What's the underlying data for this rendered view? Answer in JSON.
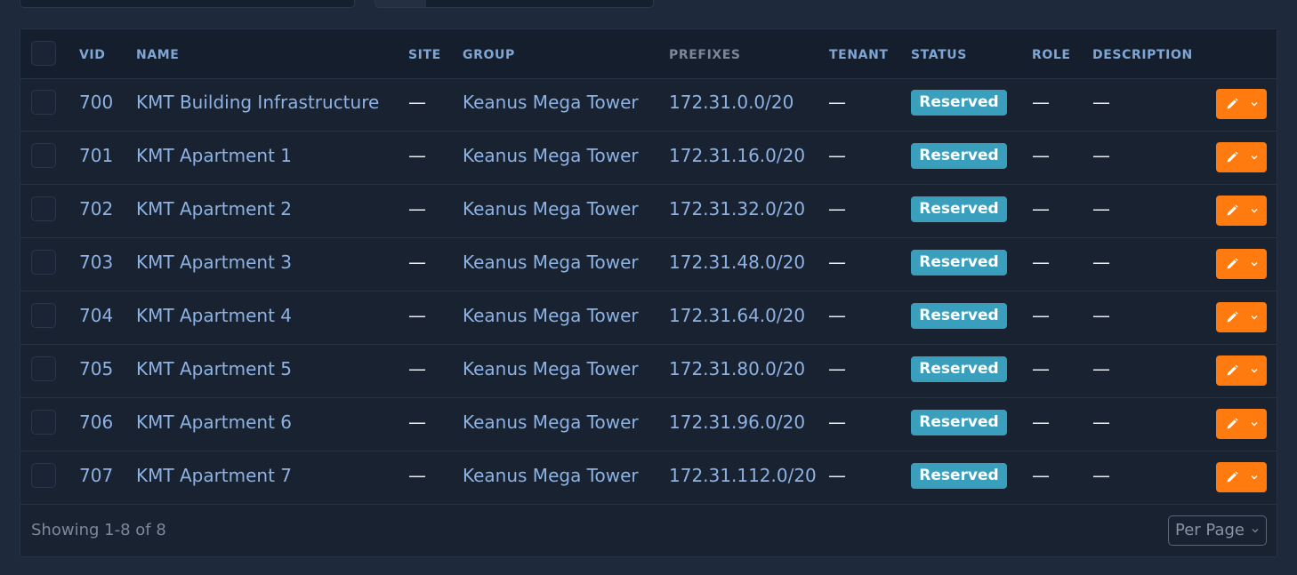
{
  "table": {
    "headers": {
      "vid": "VID",
      "name": "NAME",
      "site": "SITE",
      "group": "GROUP",
      "prefixes": "PREFIXES",
      "tenant": "TENANT",
      "status": "STATUS",
      "role": "ROLE",
      "description": "DESCRIPTION"
    },
    "rows": [
      {
        "vid": "700",
        "name": "KMT Building Infrastructure",
        "site": "—",
        "group": "Keanus Mega Tower",
        "prefixes": "172.31.0.0/20",
        "tenant": "—",
        "status": "Reserved",
        "role": "—",
        "description": "—"
      },
      {
        "vid": "701",
        "name": "KMT Apartment 1",
        "site": "—",
        "group": "Keanus Mega Tower",
        "prefixes": "172.31.16.0/20",
        "tenant": "—",
        "status": "Reserved",
        "role": "—",
        "description": "—"
      },
      {
        "vid": "702",
        "name": "KMT Apartment 2",
        "site": "—",
        "group": "Keanus Mega Tower",
        "prefixes": "172.31.32.0/20",
        "tenant": "—",
        "status": "Reserved",
        "role": "—",
        "description": "—"
      },
      {
        "vid": "703",
        "name": "KMT Apartment 3",
        "site": "—",
        "group": "Keanus Mega Tower",
        "prefixes": "172.31.48.0/20",
        "tenant": "—",
        "status": "Reserved",
        "role": "—",
        "description": "—"
      },
      {
        "vid": "704",
        "name": "KMT Apartment 4",
        "site": "—",
        "group": "Keanus Mega Tower",
        "prefixes": "172.31.64.0/20",
        "tenant": "—",
        "status": "Reserved",
        "role": "—",
        "description": "—"
      },
      {
        "vid": "705",
        "name": "KMT Apartment 5",
        "site": "—",
        "group": "Keanus Mega Tower",
        "prefixes": "172.31.80.0/20",
        "tenant": "—",
        "status": "Reserved",
        "role": "—",
        "description": "—"
      },
      {
        "vid": "706",
        "name": "KMT Apartment 6",
        "site": "—",
        "group": "Keanus Mega Tower",
        "prefixes": "172.31.96.0/20",
        "tenant": "—",
        "status": "Reserved",
        "role": "—",
        "description": "—"
      },
      {
        "vid": "707",
        "name": "KMT Apartment 7",
        "site": "—",
        "group": "Keanus Mega Tower",
        "prefixes": "172.31.112.0/20",
        "tenant": "—",
        "status": "Reserved",
        "role": "—",
        "description": "—"
      }
    ]
  },
  "footer": {
    "showing": "Showing 1-8 of 8",
    "per_page_label": "Per Page"
  },
  "icons": {
    "edit": "pencil-icon",
    "dropdown": "chevron-down-icon"
  },
  "colors": {
    "background": "#1e293b",
    "card": "#182231",
    "link": "#8db2e3",
    "status_reserved": "#3a9fbd",
    "action": "#ff7a0f"
  }
}
